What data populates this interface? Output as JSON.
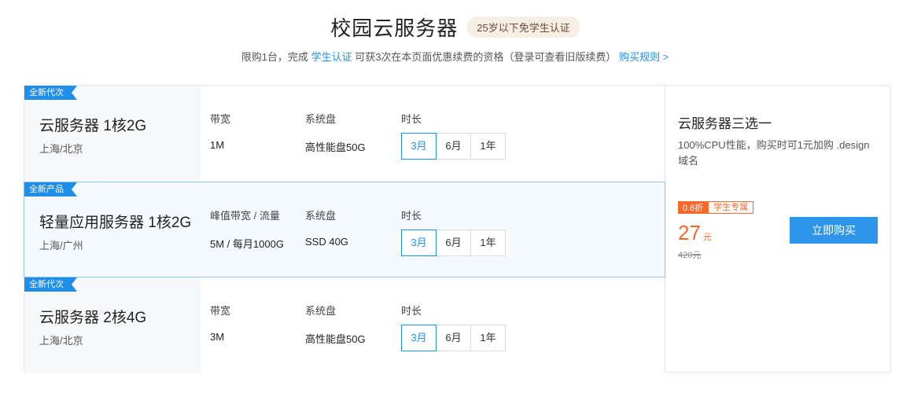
{
  "header": {
    "title": "校园云服务器",
    "badge": "25岁以下免学生认证",
    "subtitle_prefix": "限购1台，完成",
    "subtitle_link": "学生认证",
    "subtitle_middle": "可获3次在本页面优惠续费的资格（登录可查看旧版续费）",
    "rules_link": "购买规则 >"
  },
  "products": [
    {
      "tag": "全新代次",
      "name": "云服务器 1核2G",
      "region": "上海/北京",
      "col1_label": "带宽",
      "col1_value": "1M",
      "col2_label": "系统盘",
      "col2_value": "高性能盘50G",
      "duration_label": "时长",
      "durations": [
        "3月",
        "6月",
        "1年"
      ],
      "selected_duration": "3月"
    },
    {
      "tag": "全新产品",
      "name": "轻量应用服务器 1核2G",
      "region": "上海/广州",
      "col1_label": "峰值带宽 / 流量",
      "col1_value": "5M / 每月1000G",
      "col2_label": "系统盘",
      "col2_value": "SSD 40G",
      "duration_label": "时长",
      "durations": [
        "3月",
        "6月",
        "1年"
      ],
      "selected_duration": "3月"
    },
    {
      "tag": "全新代次",
      "name": "云服务器 2核4G",
      "region": "上海/北京",
      "col1_label": "带宽",
      "col1_value": "3M",
      "col2_label": "系统盘",
      "col2_value": "高性能盘50G",
      "duration_label": "时长",
      "durations": [
        "3月",
        "6月",
        "1年"
      ],
      "selected_duration": "3月"
    }
  ],
  "summary": {
    "title": "云服务器三选一",
    "description": "100%CPU性能，购买时可1元加购 .design 域名",
    "discount_badge": "0.6折",
    "student_badge": "学生专属",
    "price": "27",
    "price_unit": "元",
    "original_price": "420元",
    "buy_button": "立即购买"
  },
  "colors": {
    "accent": "#1f8ee8",
    "orange": "#f5692c",
    "button": "#2d95ea"
  }
}
